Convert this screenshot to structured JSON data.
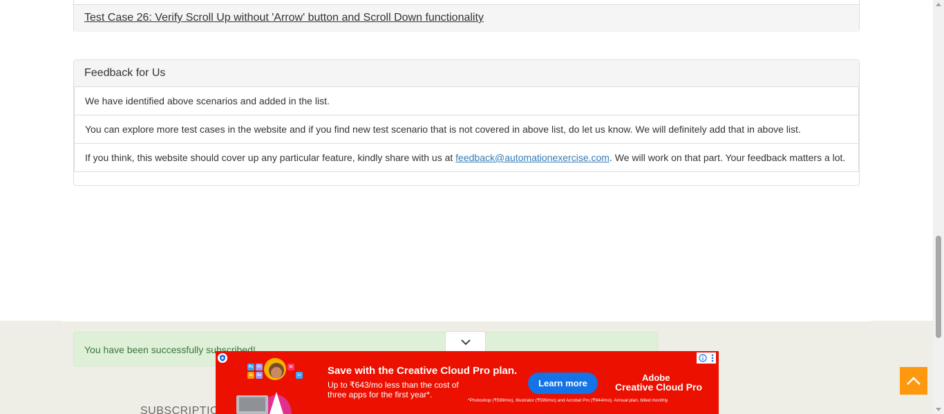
{
  "test_case": {
    "label": "Test Case 26: Verify Scroll Up without 'Arrow' button and Scroll Down functionality"
  },
  "feedback": {
    "title": "Feedback for Us",
    "item1": "We have identified above scenarios and added in the list.",
    "item2": "You can explore more test cases in the website and if you find new test scenario that is not covered in above list, do let us know. We will definitely add that in above list.",
    "item3_pre": "If you think, this website should cover up any particular feature, kindly share with us at ",
    "email": "feedback@automationexercise.com",
    "item3_post": ". We will work on that part. Your feedback matters a lot."
  },
  "footer": {
    "alert": "You have been successfully subscribed!",
    "subscription_title": "SUBSCRIPTION"
  },
  "ad": {
    "headline": "Save with the Creative Cloud Pro plan.",
    "body": "Up to ₹643/mo less than the cost of three apps for the first year*.",
    "cta": "Learn more",
    "brand_line1": "Adobe",
    "brand_line2": "Creative Cloud Pro",
    "fine_print": "*Photoshop (₹599/mo), Illustrator (₹599/mo) and Acrobat Pro (₹944/mo). Annual plan, billed monthly.",
    "tiles": [
      "Ps",
      "Pr",
      "Ai",
      "Ae",
      "Id",
      "Lr"
    ]
  },
  "colors": {
    "accent": "#fe980f",
    "alert_bg": "#dff0d8",
    "ad_red": "#eb1000",
    "cta_blue": "#1473e6"
  },
  "icons": [
    "chevron-down-icon",
    "chevron-up-icon",
    "info-icon",
    "more-vertical-icon",
    "shield-icon"
  ]
}
